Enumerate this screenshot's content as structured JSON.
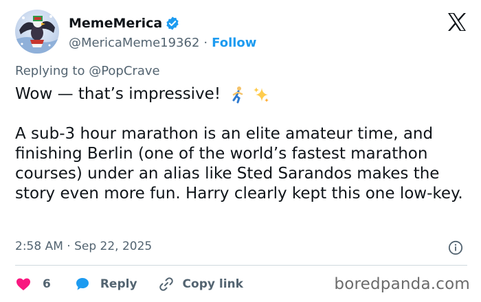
{
  "author": {
    "display_name": "MemeMerica",
    "handle": "@MericaMeme19362",
    "separator": "·",
    "follow_label": "Follow"
  },
  "reply_to": "Replying to @PopCrave",
  "tweet": {
    "line1": "Wow — that’s impressive!",
    "paragraph2": "A sub-3 hour marathon is an elite amateur time, and finishing Berlin (one of the world’s fastest marathon courses) under an alias like Sted Sarandos makes the story even more fun. Harry clearly kept this one low-key.",
    "emojis": [
      "runner-emoji",
      "sparkles-emoji"
    ]
  },
  "timestamp": "2:58 AM · Sep 22, 2025",
  "actions": {
    "like_count": "6",
    "reply_label": "Reply",
    "copy_link_label": "Copy link"
  },
  "watermark": "boredpanda.com",
  "colors": {
    "accent": "#1d9bf0",
    "like": "#f91880",
    "muted": "#536471",
    "text": "#0f1419"
  }
}
